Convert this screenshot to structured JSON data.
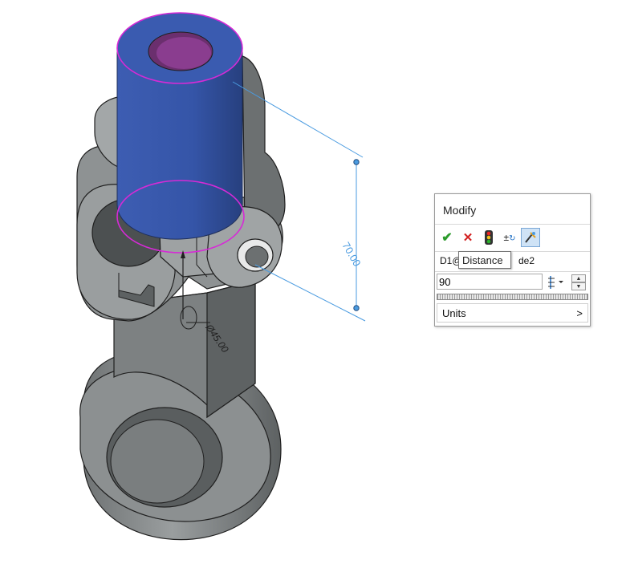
{
  "viewport": {
    "dimension_distance": "70.00",
    "dimension_diameter": "Ø45.00"
  },
  "dialog": {
    "title": "Modify",
    "toolbar": [
      {
        "name": "ok-check-icon",
        "glyph": "✔"
      },
      {
        "name": "cancel-x-icon",
        "glyph": "✕"
      },
      {
        "name": "rebuild-traffic-light-icon",
        "glyph": ""
      },
      {
        "name": "reverse-sense-icon",
        "glyph": "±"
      },
      {
        "name": "mark-dimension-icon",
        "glyph": ""
      }
    ],
    "dimension_name_left": "D1@",
    "dimension_name_right": "de2",
    "value": "90",
    "units_label": "Units",
    "units_arrow": ">"
  },
  "tooltip": {
    "text": "Distance"
  },
  "colors": {
    "highlight_face": "#3558a8",
    "edge_magenta": "#d62ad6",
    "dimension_blue": "#4a9be0",
    "part_gray": "#8a8e8f"
  }
}
